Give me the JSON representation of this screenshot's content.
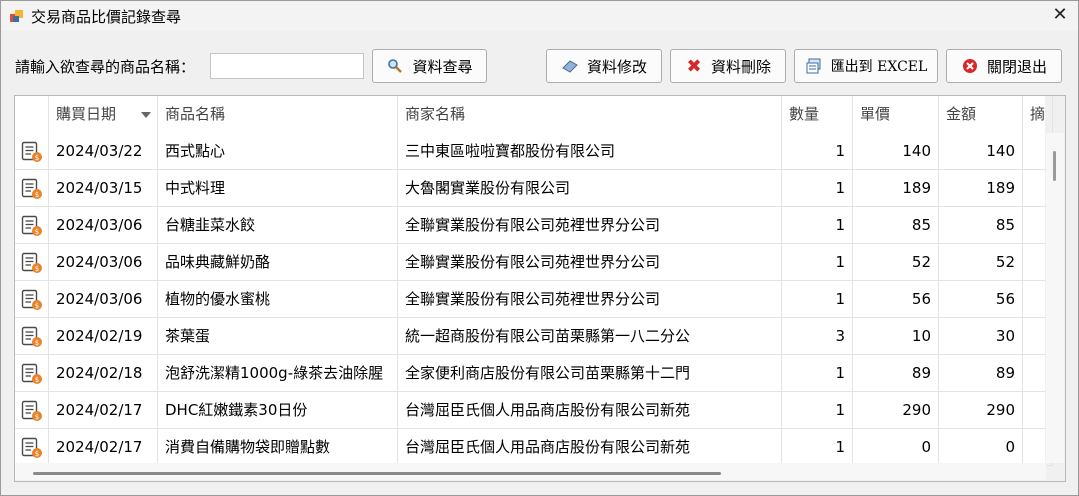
{
  "window": {
    "title": "交易商品比價記錄查尋"
  },
  "toolbar": {
    "search_label": "請輸入欲查尋的商品名稱：",
    "search_value": "",
    "query_button": "資料查尋",
    "edit_button": "資料修改",
    "delete_button": "資料刪除",
    "export_button": "匯出到 EXCEL",
    "exit_button": "關閉退出"
  },
  "table": {
    "columns": [
      "購買日期",
      "商品名稱",
      "商家名稱",
      "數量",
      "單價",
      "金額",
      "摘"
    ],
    "rows": [
      [
        "2024/03/22",
        "西式點心",
        "三中東區啦啦寶都股份有限公司",
        "1",
        "140",
        "140"
      ],
      [
        "2024/03/15",
        "中式料理",
        "大魯閣實業股份有限公司",
        "1",
        "189",
        "189"
      ],
      [
        "2024/03/06",
        "台糖韭菜水餃",
        "全聯實業股份有限公司苑裡世界分公司",
        "1",
        "85",
        "85"
      ],
      [
        "2024/03/06",
        "品味典藏鮮奶酪",
        "全聯實業股份有限公司苑裡世界分公司",
        "1",
        "52",
        "52"
      ],
      [
        "2024/03/06",
        "植物的優水蜜桃",
        "全聯實業股份有限公司苑裡世界分公司",
        "1",
        "56",
        "56"
      ],
      [
        "2024/02/19",
        "茶葉蛋",
        "統一超商股份有限公司苗栗縣第一八二分公",
        "3",
        "10",
        "30"
      ],
      [
        "2024/02/18",
        "泡舒洗潔精1000g-綠茶去油除腥",
        "全家便利商店股份有限公司苗栗縣第十二門",
        "1",
        "89",
        "89"
      ],
      [
        "2024/02/17",
        "DHC紅嫩鐵素30日份",
        "台灣屈臣氏個人用品商店股份有限公司新苑",
        "1",
        "290",
        "290"
      ],
      [
        "2024/02/17",
        "消費自備購物袋即贈點數",
        "台灣屈臣氏個人用品商店股份有限公司新苑",
        "1",
        "0",
        "0"
      ]
    ]
  },
  "colors": {
    "accent_icon": "#3a6ea5",
    "delete_icon": "#d9262b",
    "exit_icon": "#d9262b",
    "row_icon_badge": "#e8832a"
  }
}
